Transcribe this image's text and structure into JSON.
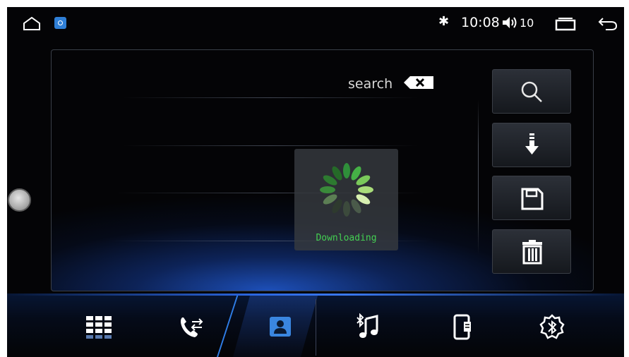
{
  "status_bar": {
    "clock": "10:08",
    "volume_level": "10",
    "icons": [
      "home-icon",
      "app-badge-icon",
      "bluetooth-icon",
      "volume-icon",
      "recent-apps-icon",
      "back-icon"
    ]
  },
  "phonebook": {
    "search_label": "search",
    "loading_text": "Downloading",
    "side_buttons": [
      "search-icon",
      "download-icon",
      "save-icon",
      "delete-icon"
    ]
  },
  "bottom_nav": {
    "items": [
      "dialpad-icon",
      "call-log-icon",
      "contacts-icon",
      "bluetooth-music-icon",
      "device-icon",
      "bluetooth-settings-icon"
    ],
    "active": "contacts-icon"
  },
  "colors": {
    "accent": "#2f7ee8",
    "loading_text": "#44d052",
    "background": "#040406"
  }
}
